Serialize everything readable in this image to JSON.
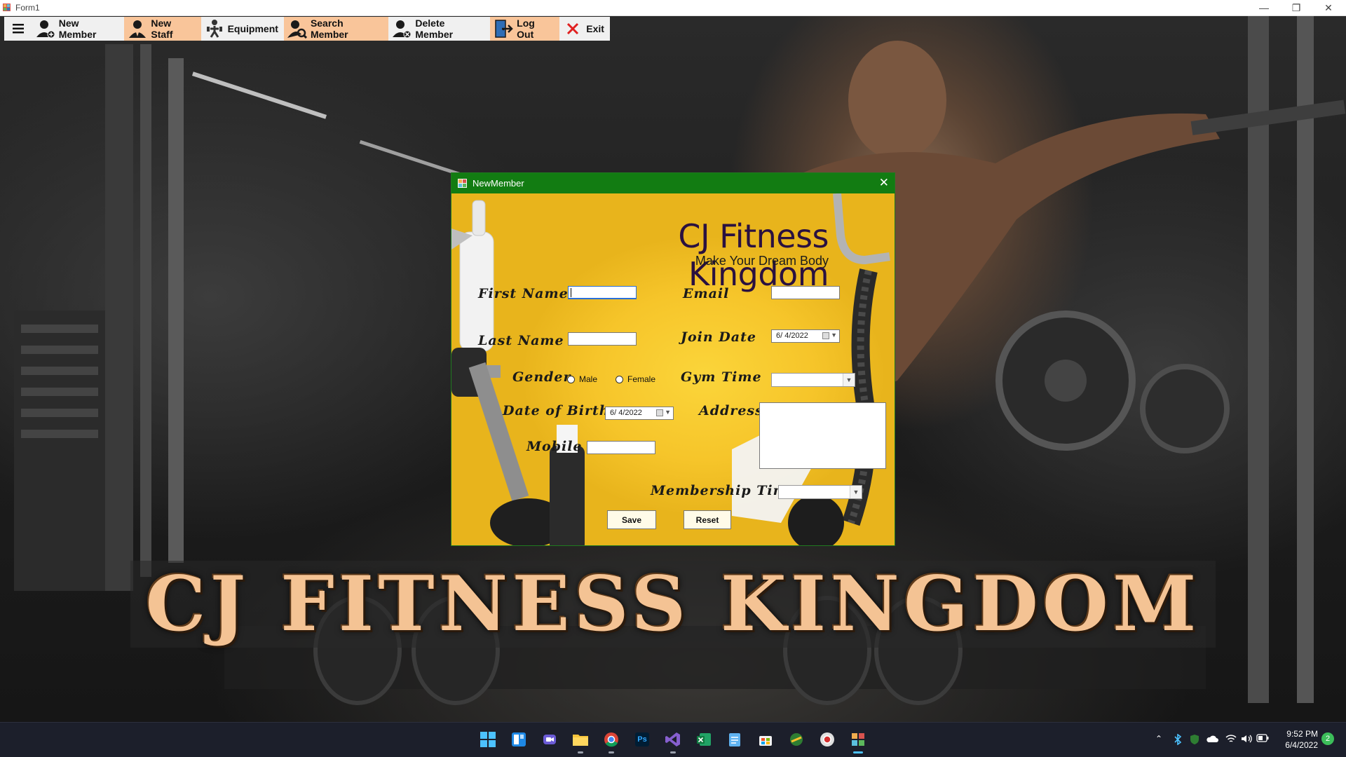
{
  "window": {
    "title": "Form1",
    "controls": {
      "minimize": "—",
      "restore": "❐",
      "close": "✕"
    }
  },
  "menu": {
    "items": [
      {
        "id": "new-member",
        "label": "New Member",
        "icon": "add-user-icon"
      },
      {
        "id": "new-staff",
        "label": "New Staff",
        "icon": "staff-icon"
      },
      {
        "id": "equipment",
        "label": "Equipment",
        "icon": "equipment-icon"
      },
      {
        "id": "search-member",
        "label": "Search Member",
        "icon": "search-user-icon"
      },
      {
        "id": "delete-member",
        "label": "Delete Member",
        "icon": "delete-user-icon"
      },
      {
        "id": "log-out",
        "label": "Log Out",
        "icon": "logout-icon"
      },
      {
        "id": "exit",
        "label": "Exit",
        "icon": "close-icon"
      }
    ],
    "highlighted": [
      "New Staff",
      "Search Member",
      "Log Out"
    ]
  },
  "banner": {
    "text": "CJ FITNESS KINGDOM"
  },
  "dialog": {
    "title": "NewMember",
    "brand": "CJ Fitness Kingdom",
    "tagline": "Make Your Dream Body",
    "labels": {
      "first_name": "First Name",
      "last_name": "Last Name",
      "gender": "Gender",
      "dob": "Date of Birth",
      "mobile": "Mobile",
      "email": "Email",
      "join_date": "Join Date",
      "gym_time": "Gym Time",
      "address": "Address",
      "membership_time": "Membership Time"
    },
    "fields": {
      "first_name": "",
      "last_name": "",
      "mobile": "",
      "email": "",
      "address": "",
      "join_date": "6/ 4/2022",
      "dob": "6/ 4/2022",
      "gym_time": "",
      "membership_time": ""
    },
    "gender_options": [
      "Male",
      "Female"
    ],
    "buttons": {
      "save": "Save",
      "reset": "Reset"
    }
  },
  "taskbar": {
    "apps": [
      "start-icon",
      "widgets-icon",
      "teams-chat-icon",
      "file-explorer-icon",
      "chrome-icon",
      "photoshop-icon",
      "visual-studio-icon",
      "excel-icon",
      "notepad-icon",
      "store-icon",
      "maps-icon",
      "chrome-beta-icon",
      "winforms-app-icon"
    ],
    "photoshop_label": "Ps",
    "tray": [
      "chevron-up-icon",
      "bluetooth-icon",
      "defender-icon",
      "onedrive-icon",
      "wifi-icon",
      "volume-icon",
      "battery-icon"
    ],
    "time": "9:52 PM",
    "date": "6/4/2022",
    "notifications": "2"
  },
  "colors": {
    "dialog_title": "#127c12",
    "dialog_bg": "#f3c524",
    "menu_highlight": "#f9c59a",
    "banner_text": "#f4c394"
  }
}
